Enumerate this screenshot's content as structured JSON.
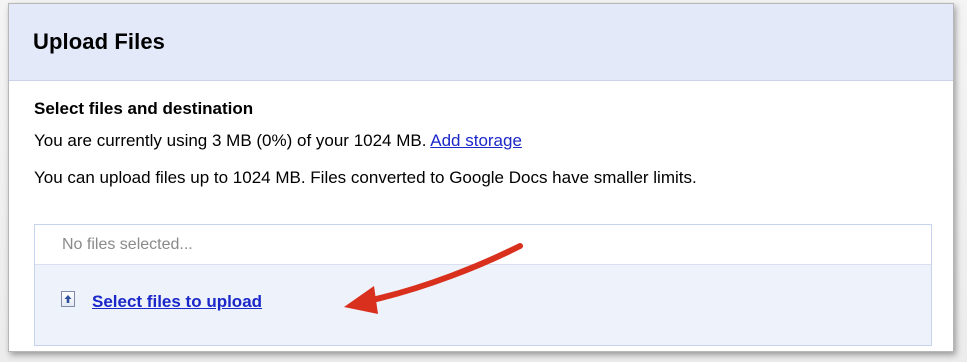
{
  "dialog": {
    "title": "Upload Files",
    "section_heading": "Select files and destination",
    "storage_text": "You are currently using 3 MB (0%) of your 1024 MB.",
    "storage_link": "Add storage",
    "limit_text": "You can upload files up to 1024 MB. Files converted to Google Docs have smaller limits.",
    "file_field_text": "No files selected...",
    "select_files_label": "Select files to upload"
  },
  "icons": {
    "upload": "upload-arrow-icon",
    "annotation_arrow": "red-arrow-annotation"
  },
  "colors": {
    "header_bg": "#e3e9f8",
    "panel_bg": "#eef2fb",
    "link": "#1a27c9",
    "annotation": "#d9301e"
  }
}
